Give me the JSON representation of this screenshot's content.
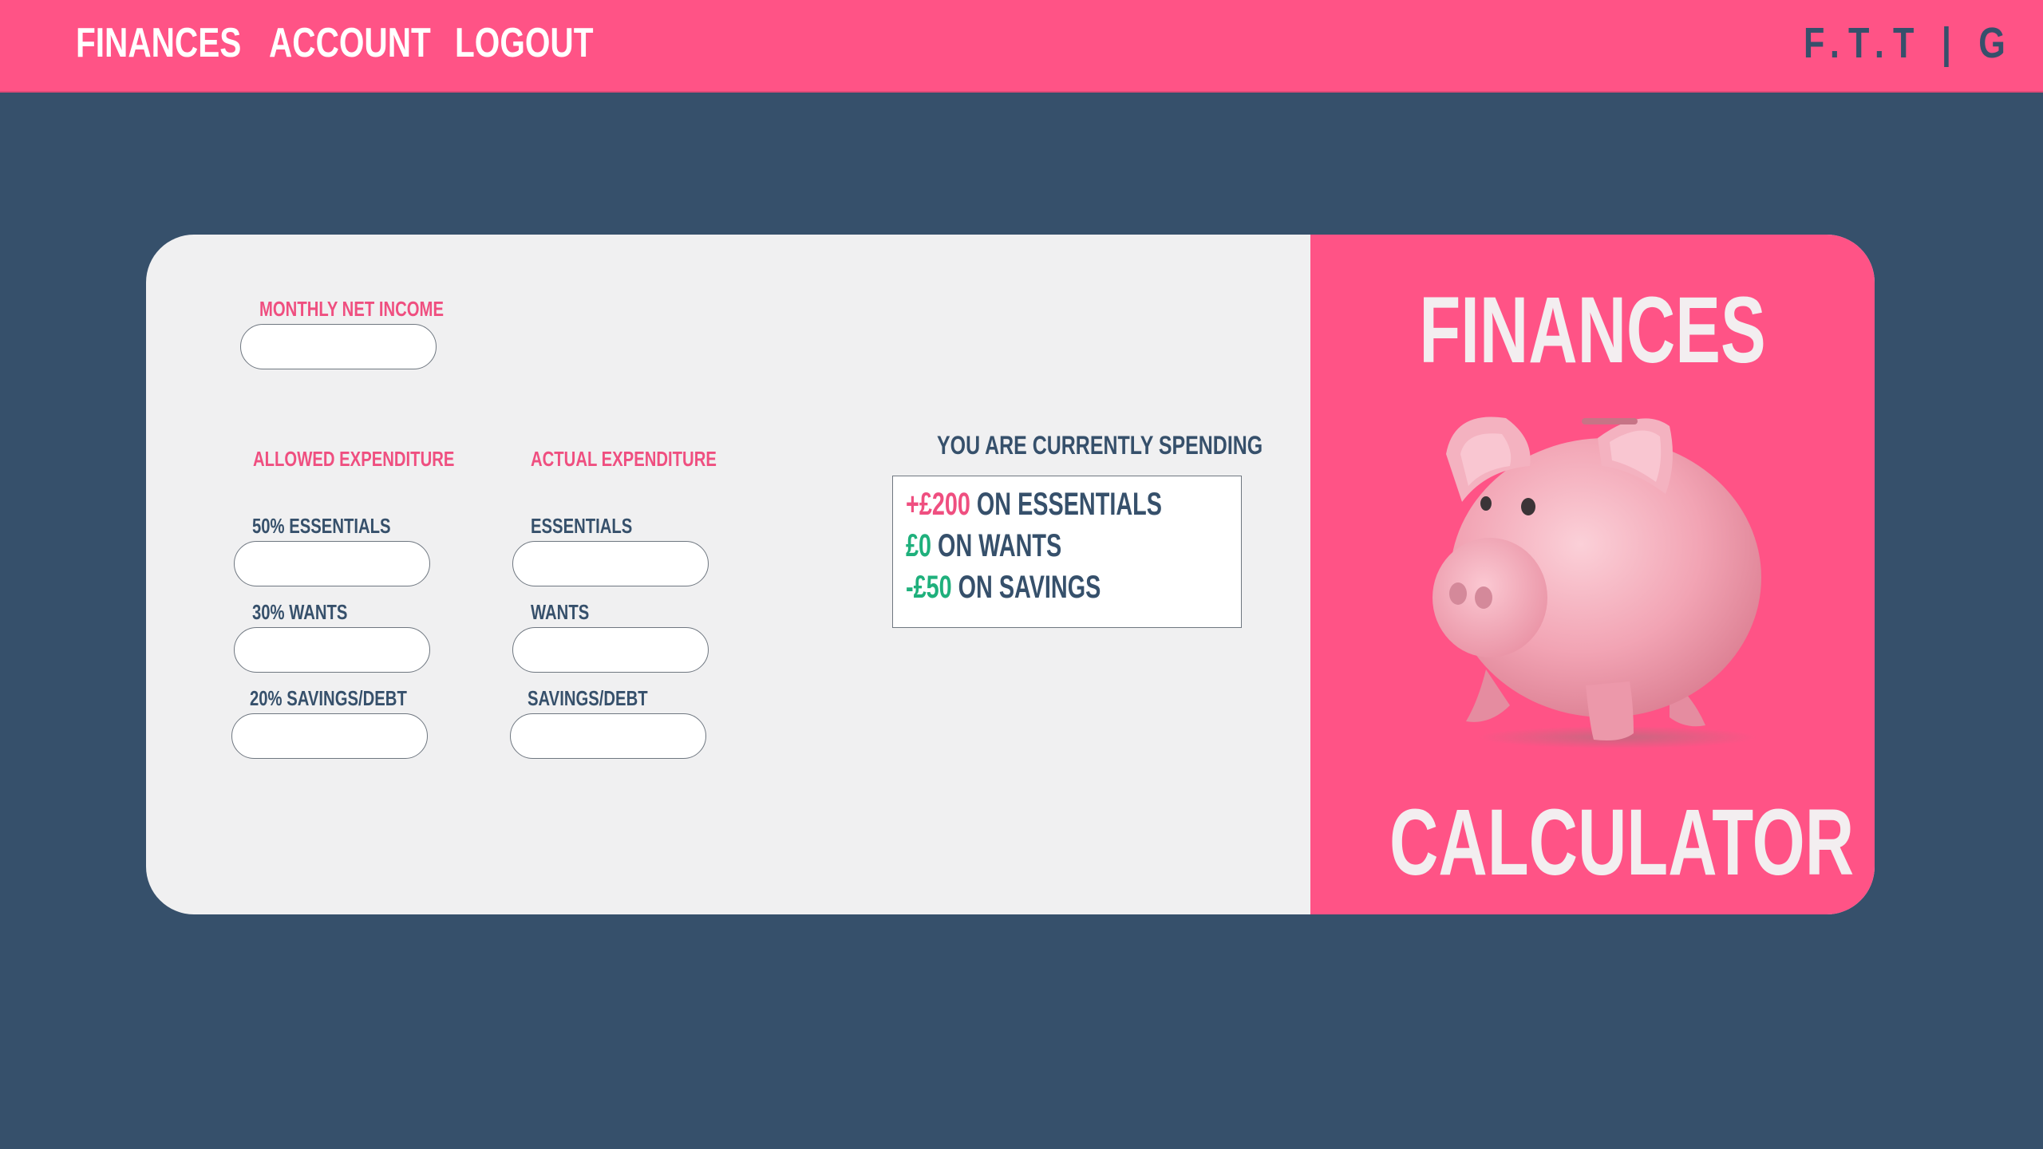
{
  "nav": {
    "links": [
      "FINANCES",
      "ACCOUNT",
      "LOGOUT"
    ],
    "brand": "F.T.T | G"
  },
  "form": {
    "income_label": "MONTHLY NET INCOME",
    "allowed_heading": "ALLOWED EXPENDITURE",
    "actual_heading": "ACTUAL EXPENDITURE",
    "allowed": {
      "essentials_label": "50% ESSENTIALS",
      "wants_label": "30% WANTS",
      "savings_label": "20% SAVINGS/DEBT"
    },
    "actual": {
      "essentials_label": "ESSENTIALS",
      "wants_label": "WANTS",
      "savings_label": "SAVINGS/DEBT"
    }
  },
  "spending": {
    "title": "YOU ARE CURRENTLY SPENDING",
    "lines": [
      {
        "amount": "+£200",
        "text": " ON ESSENTIALS",
        "color": "#ef4f80"
      },
      {
        "amount": "£0",
        "text": " ON WANTS",
        "color": "#1fb07c"
      },
      {
        "amount": "-£50",
        "text": " ON SAVINGS",
        "color": "#1fb07c"
      }
    ]
  },
  "hero": {
    "title_top": "FINANCES",
    "title_bottom": "CALCULATOR",
    "image": "piggy-bank"
  },
  "colors": {
    "accent": "#ff5386",
    "background": "#36506b",
    "panel": "#f0f0f1"
  }
}
